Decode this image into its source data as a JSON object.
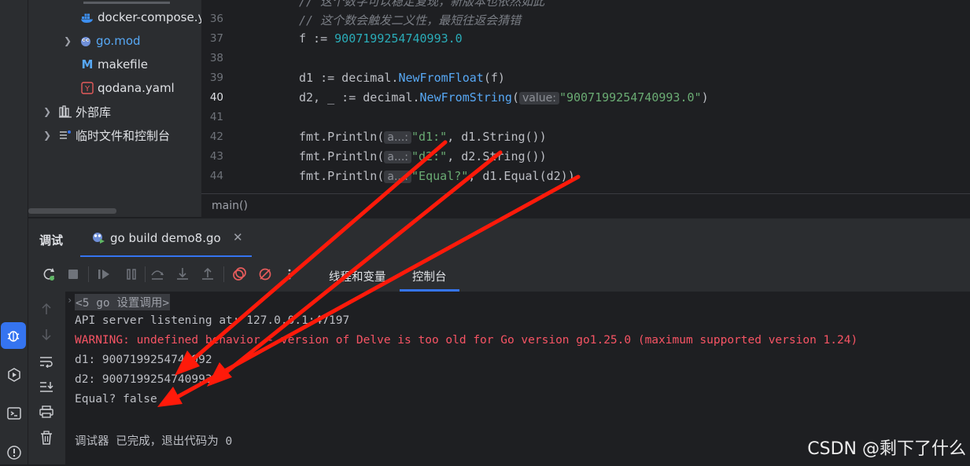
{
  "tree": {
    "items": [
      {
        "label": "docker-compose.y",
        "icon": "docker-icon"
      },
      {
        "label": "go.mod",
        "icon": "gopher-icon"
      },
      {
        "label": "makefile",
        "icon": "makefile-icon"
      },
      {
        "label": "qodana.yaml",
        "icon": "yaml-icon"
      },
      {
        "label": "外部库",
        "icon": "library-icon"
      },
      {
        "label": "临时文件和控制台",
        "icon": "scratches-icon"
      }
    ]
  },
  "editor": {
    "line_numbers": [
      "36",
      "37",
      "38",
      "39",
      "40",
      "41",
      "42",
      "43",
      "44"
    ],
    "lines": {
      "l35": "// 这个数字可以稳定复现，新版本也依然如此",
      "l36": "// 这个数会触发二义性，最短往返会猜错",
      "l37_a": "f := ",
      "l37_num": "9007199254740993.0",
      "l39_a": "d1 := decimal.",
      "l39_fn": "NewFromFloat",
      "l39_b": "(f)",
      "l40_a": "d2, _ := decimal.",
      "l40_fn": "NewFromString",
      "l40_b": "(",
      "l40_hint": "value:",
      "l40_str": "\"9007199254740993.0\"",
      "l40_c": ")",
      "l42_a": "fmt.Println(",
      "l42_hint": "a...:",
      "l42_str": "\"d1:\"",
      "l42_b": ", d1.String())",
      "l43_a": "fmt.Println(",
      "l43_hint": "a...:",
      "l43_str": "\"d2:\"",
      "l43_b": ", d2.String())",
      "l44_a": "fmt.Println(",
      "l44_hint": "a...:",
      "l44_str": "\"Equal?\"",
      "l44_b": ", d1.Equal(d2))"
    },
    "breadcrumb": "main()"
  },
  "debug": {
    "title": "调试",
    "tab_label": "go build demo8.go",
    "subtabs": [
      "线程和变量",
      "控制台"
    ],
    "toolbar_icons": [
      "rerun-icon",
      "stop-icon",
      "resume-icon",
      "pause-icon",
      "step-over-icon",
      "step-into-icon",
      "step-out-icon",
      "view-breakpoints-icon",
      "mute-breakpoints-icon",
      "more-icon"
    ],
    "console": {
      "collapsed": "<5 go 设置调用>",
      "line1": "API server listening at: 127.0.0.1:47197",
      "warning": "WARNING: undefined behavior - version of Delve is too old for Go version go1.25.0 (maximum supported version 1.24)",
      "d1": "d1: 9007199254740992",
      "d2": "d2: 9007199254740993",
      "equal": "Equal? false",
      "exit": "调试器 已完成，退出代码为 0"
    }
  },
  "watermark": "CSDN @剩下了什么",
  "colors": {
    "accent": "#3574f0",
    "warning": "#f75464",
    "string": "#6aab73",
    "number": "#2aacb8",
    "arrow": "#ff1a0a"
  }
}
